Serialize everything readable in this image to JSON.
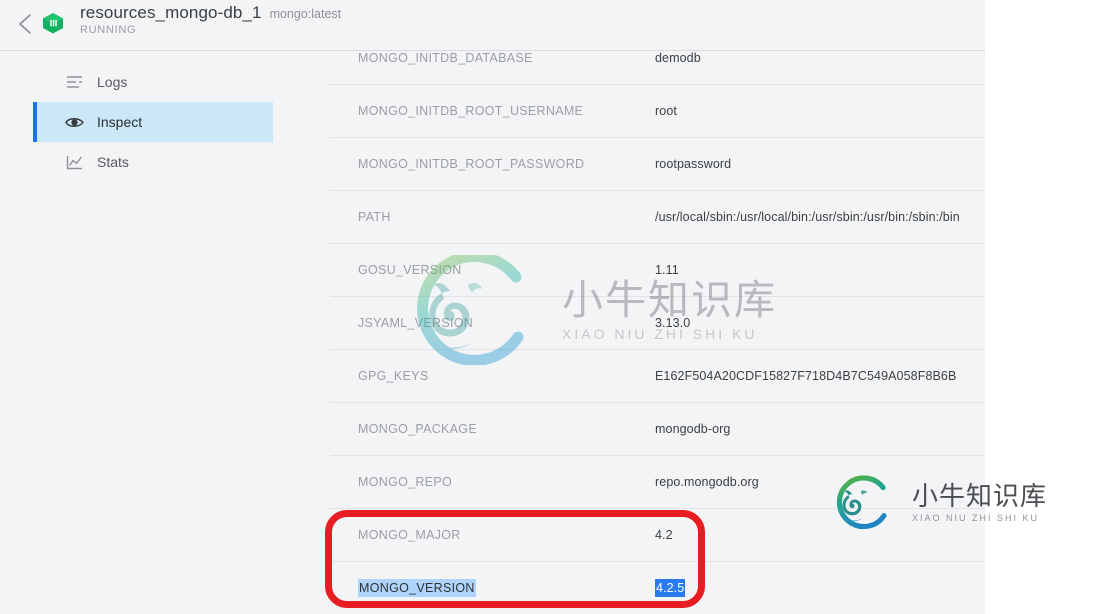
{
  "header": {
    "back_icon": "chevron-left-icon",
    "container_icon": "docker-container-icon",
    "container_name": "resources_mongo-db_1",
    "image_tag": "mongo:latest",
    "status": "RUNNING"
  },
  "sidebar": {
    "items": [
      {
        "label": "Logs",
        "icon": "logs-lines-icon",
        "active": false
      },
      {
        "label": "Inspect",
        "icon": "eye-icon",
        "active": true
      },
      {
        "label": "Stats",
        "icon": "chart-line-icon",
        "active": false
      }
    ],
    "active_accent": "#1a73e8",
    "active_background": "#cbe8f7"
  },
  "inspect": {
    "rows": [
      {
        "key": "MONGO_INITDB_DATABASE",
        "value": "demodb",
        "selected": false
      },
      {
        "key": "MONGO_INITDB_ROOT_USERNAME",
        "value": "root",
        "selected": false
      },
      {
        "key": "MONGO_INITDB_ROOT_PASSWORD",
        "value": "rootpassword",
        "selected": false
      },
      {
        "key": "PATH",
        "value": "/usr/local/sbin:/usr/local/bin:/usr/sbin:/usr/bin:/sbin:/bin",
        "selected": false
      },
      {
        "key": "GOSU_VERSION",
        "value": "1.11",
        "selected": false
      },
      {
        "key": "JSYAML_VERSION",
        "value": "3.13.0",
        "selected": false
      },
      {
        "key": "GPG_KEYS",
        "value": "E162F504A20CDF15827F718D4B7C549A058F8B6B",
        "selected": false
      },
      {
        "key": "MONGO_PACKAGE",
        "value": "mongodb-org",
        "selected": false
      },
      {
        "key": "MONGO_REPO",
        "value": "repo.mongodb.org",
        "selected": false
      },
      {
        "key": "MONGO_MAJOR",
        "value": "4.2",
        "selected": false
      },
      {
        "key": "MONGO_VERSION",
        "value": "4.2.5",
        "selected": true
      }
    ]
  },
  "annotation": {
    "type": "red-rounded-rectangle",
    "color": "#e81c23"
  },
  "watermarks": [
    {
      "name": "watermark-large",
      "cn": "小牛知识库",
      "pinyin": "XIAO NIU ZHI SHI KU"
    },
    {
      "name": "watermark-small",
      "cn": "小牛知识库",
      "pinyin": "XIAO NIU ZHI SHI KU"
    }
  ]
}
